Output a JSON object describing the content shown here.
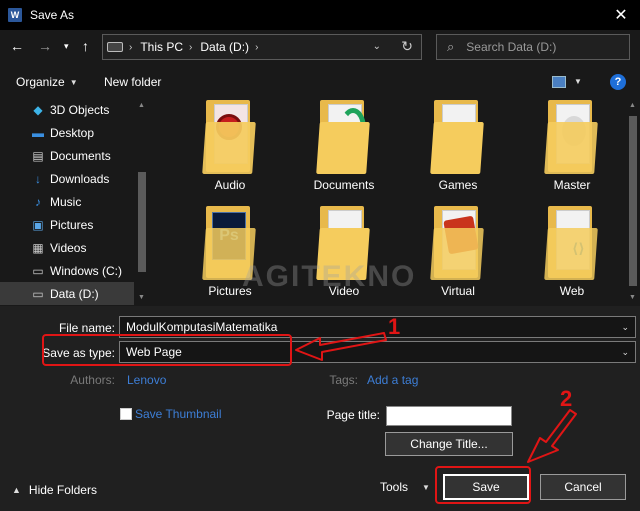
{
  "window": {
    "title": "Save As",
    "app_icon_text": "W"
  },
  "nav": {
    "breadcrumbs": [
      "This PC",
      "Data (D:)"
    ],
    "search_placeholder": "Search Data (D:)"
  },
  "toolbar": {
    "organize_label": "Organize",
    "new_folder_label": "New folder",
    "help_label": "?"
  },
  "sidebar": {
    "items": [
      {
        "label": "3D Objects",
        "icon": "cube-icon",
        "color": "#3db4e8"
      },
      {
        "label": "Desktop",
        "icon": "desktop-icon",
        "color": "#3a8fe0"
      },
      {
        "label": "Documents",
        "icon": "documents-icon",
        "color": "#d0d0d0"
      },
      {
        "label": "Downloads",
        "icon": "download-icon",
        "color": "#3a8fe0"
      },
      {
        "label": "Music",
        "icon": "music-icon",
        "color": "#3a8fe0"
      },
      {
        "label": "Pictures",
        "icon": "pictures-icon",
        "color": "#5aa7e8"
      },
      {
        "label": "Videos",
        "icon": "videos-icon",
        "color": "#c8c8c8"
      },
      {
        "label": "Windows (C:)",
        "icon": "windows-drive-icon",
        "color": "#c8c8c8"
      },
      {
        "label": "Data (D:)",
        "icon": "drive-icon",
        "color": "#c8c8c8",
        "selected": true
      }
    ]
  },
  "folders": [
    {
      "label": "Audio"
    },
    {
      "label": "Documents"
    },
    {
      "label": "Games"
    },
    {
      "label": "Master"
    },
    {
      "label": "Pictures"
    },
    {
      "label": "Video"
    },
    {
      "label": "Virtual"
    },
    {
      "label": "Web"
    }
  ],
  "watermark": "AGITEKNO",
  "form": {
    "file_name_label": "File name:",
    "file_name_value": "ModulKomputasiMatematika",
    "save_type_label": "Save as type:",
    "save_type_value": "Web Page",
    "authors_label": "Authors:",
    "authors_value": "Lenovo",
    "tags_label": "Tags:",
    "tags_value": "Add a tag",
    "thumbnail_label": "Save Thumbnail",
    "page_title_label": "Page title:",
    "change_title_label": "Change Title...",
    "hide_folders_label": "Hide Folders",
    "tools_label": "Tools",
    "save_label": "Save",
    "cancel_label": "Cancel"
  },
  "annotations": {
    "step1": "1",
    "step2": "2"
  },
  "colors": {
    "accent_red": "#e01515",
    "link_blue": "#3d7ed6",
    "folder_yellow": "#f5cc5d"
  }
}
